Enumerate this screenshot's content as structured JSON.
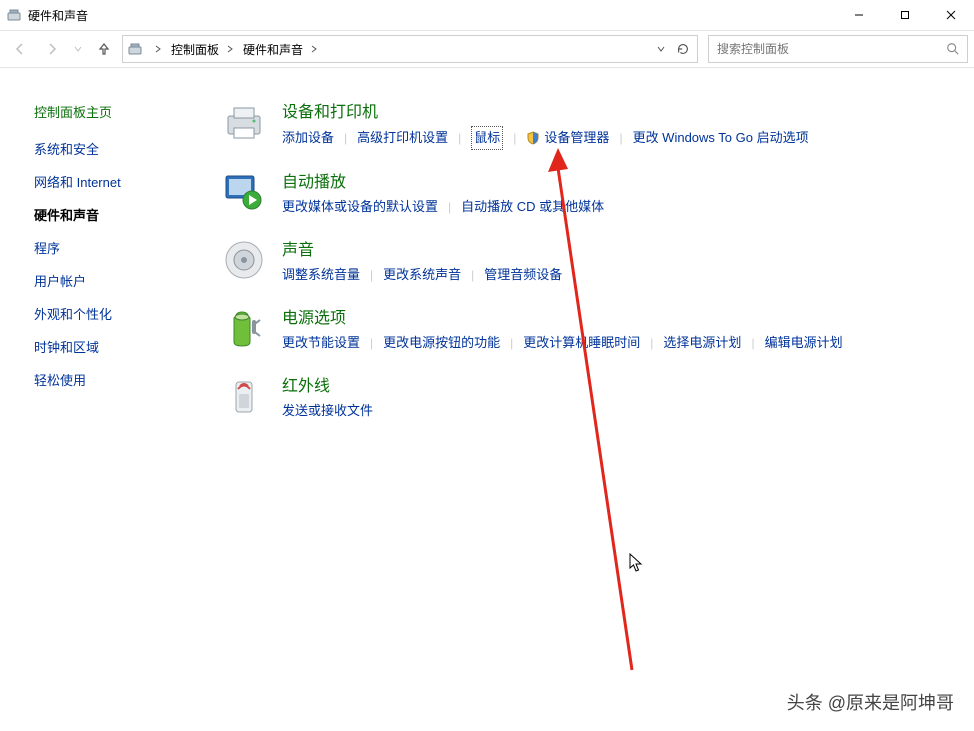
{
  "window": {
    "title": "硬件和声音"
  },
  "breadcrumb": {
    "root": "控制面板",
    "current": "硬件和声音"
  },
  "search": {
    "placeholder": "搜索控制面板"
  },
  "sidebar": {
    "heading": "控制面板主页",
    "items": [
      {
        "label": "系统和安全",
        "current": false
      },
      {
        "label": "网络和 Internet",
        "current": false
      },
      {
        "label": "硬件和声音",
        "current": true
      },
      {
        "label": "程序",
        "current": false
      },
      {
        "label": "用户帐户",
        "current": false
      },
      {
        "label": "外观和个性化",
        "current": false
      },
      {
        "label": "时钟和区域",
        "current": false
      },
      {
        "label": "轻松使用",
        "current": false
      }
    ]
  },
  "categories": {
    "devices": {
      "title": "设备和打印机",
      "links": {
        "add_device": "添加设备",
        "adv_printer": "高级打印机设置",
        "mouse": "鼠标",
        "device_manager": "设备管理器",
        "wintogo": "更改 Windows To Go 启动选项"
      }
    },
    "autoplay": {
      "title": "自动播放",
      "links": {
        "change_defaults": "更改媒体或设备的默认设置",
        "cd_media": "自动播放 CD 或其他媒体"
      }
    },
    "sound": {
      "title": "声音",
      "links": {
        "vol": "调整系统音量",
        "change_sounds": "更改系统声音",
        "manage_audio": "管理音频设备"
      }
    },
    "power": {
      "title": "电源选项",
      "links": {
        "energy": "更改节能设置",
        "buttons": "更改电源按钮的功能",
        "sleep": "更改计算机睡眠时间",
        "plan": "选择电源计划",
        "edit_plan": "编辑电源计划"
      }
    },
    "infrared": {
      "title": "红外线",
      "links": {
        "send_recv": "发送或接收文件"
      }
    }
  },
  "watermark": "头条 @原来是阿坤哥"
}
